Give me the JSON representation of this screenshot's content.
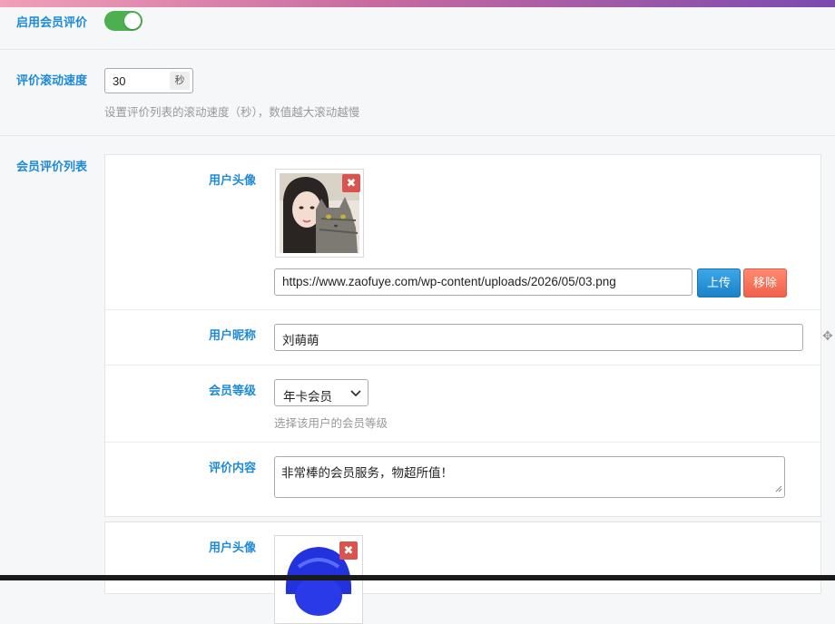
{
  "settings": {
    "enable_reviews_label": "启用会员评价",
    "enable_reviews_on": true,
    "scroll_speed_label": "评价滚动速度",
    "scroll_speed_value": "30",
    "scroll_speed_unit": "秒",
    "scroll_speed_help": "设置评价列表的滚动速度（秒），数值越大滚动越慢",
    "review_list_label": "会员评价列表"
  },
  "reviews": [
    {
      "avatar_label": "用户头像",
      "avatar_url": "https://www.zaofuye.com/wp-content/uploads/2026/05/03.png",
      "upload_button": "上传",
      "remove_button": "移除",
      "nickname_label": "用户昵称",
      "nickname": "刘萌萌",
      "level_label": "会员等级",
      "level_value": "年卡会员",
      "level_help": "选择该用户的会员等级",
      "content_label": "评价内容",
      "content": "非常棒的会员服务，物超所值！"
    },
    {
      "avatar_label": "用户头像"
    }
  ],
  "icons": {
    "remove_avatar": "close-icon",
    "drag": "move-icon",
    "select": "chevron-down-icon"
  },
  "colors": {
    "label_blue": "#1e8ad6",
    "toggle_on": "#4caf50",
    "upload_btn": "#1a82c8",
    "remove_btn": "#f0604a"
  }
}
